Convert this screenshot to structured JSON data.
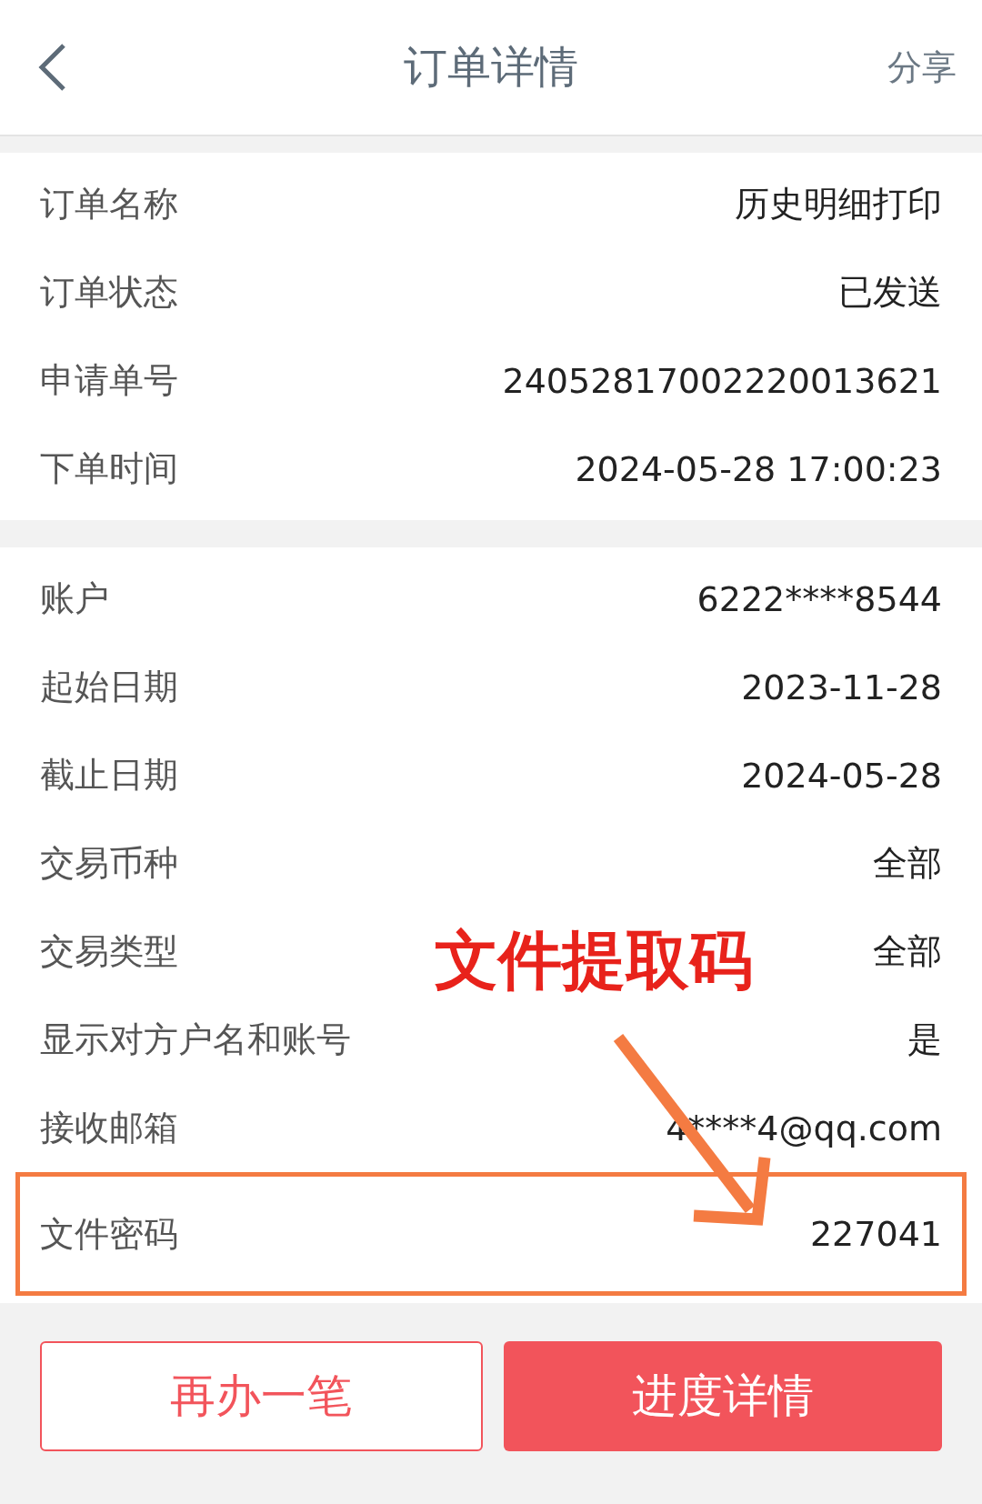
{
  "header": {
    "title": "订单详情",
    "action": "分享"
  },
  "sections": [
    {
      "rows": [
        {
          "label": "订单名称",
          "value": "历史明细打印",
          "highlighted": false
        },
        {
          "label": "订单状态",
          "value": "已发送",
          "highlighted": false
        },
        {
          "label": "申请单号",
          "value": "24052817002220013621",
          "highlighted": false
        },
        {
          "label": "下单时间",
          "value": "2024-05-28 17:00:23",
          "highlighted": false
        }
      ]
    },
    {
      "rows": [
        {
          "label": "账户",
          "value": "6222****8544",
          "highlighted": false
        },
        {
          "label": "起始日期",
          "value": "2023-11-28",
          "highlighted": false
        },
        {
          "label": "截止日期",
          "value": "2024-05-28",
          "highlighted": false
        },
        {
          "label": "交易币种",
          "value": "全部",
          "highlighted": false
        },
        {
          "label": "交易类型",
          "value": "全部",
          "highlighted": false
        },
        {
          "label": "显示对方户名和账号",
          "value": "是",
          "highlighted": false
        },
        {
          "label": "接收邮箱",
          "value": "4****4@qq.com",
          "highlighted": false
        },
        {
          "label": "文件密码",
          "value": "227041",
          "highlighted": true
        }
      ]
    }
  ],
  "buttons": [
    {
      "label": "再办一笔",
      "kind": "outline"
    },
    {
      "label": "进度详情",
      "kind": "primary"
    }
  ],
  "annotation": {
    "caption": "文件提取码"
  }
}
